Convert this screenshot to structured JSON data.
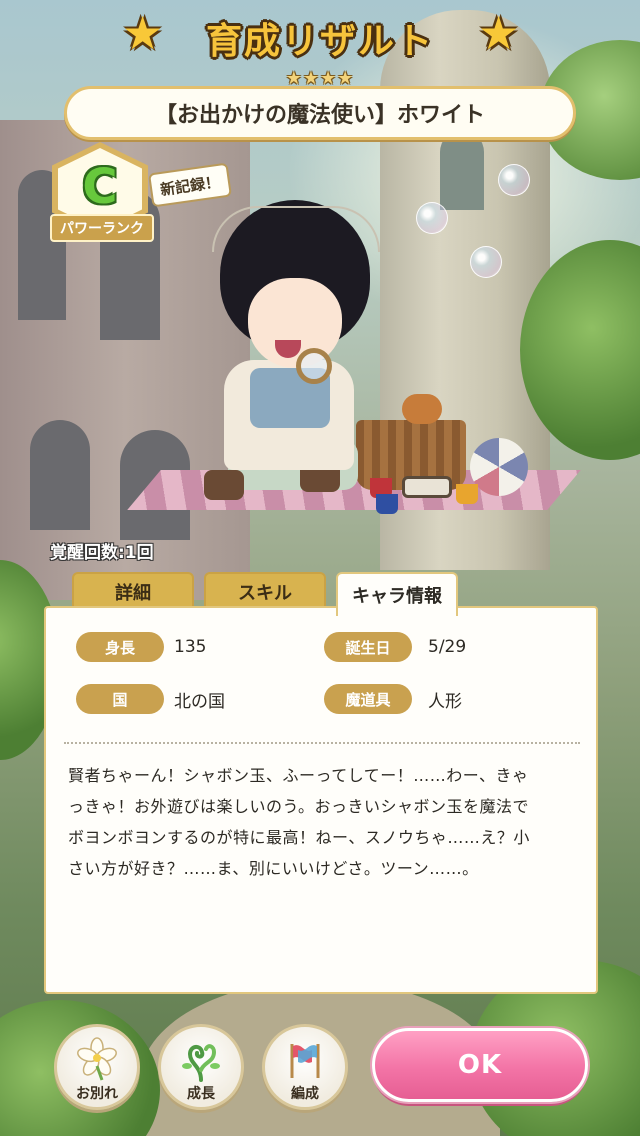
{
  "header": {
    "title": "育成リザルト",
    "rarity_stars": "★★★★",
    "card_name": "【お出かけの魔法使い】ホワイト"
  },
  "rank": {
    "letter": "C",
    "label": "パワーランク",
    "new_record": "新記録！"
  },
  "awakening": "覚醒回数:1回",
  "tabs": [
    {
      "label": "詳細",
      "active": false
    },
    {
      "label": "スキル",
      "active": false
    },
    {
      "label": "キャラ情報",
      "active": true
    }
  ],
  "info": {
    "height_label": "身長",
    "height_value": "135",
    "birthday_label": "誕生日",
    "birthday_value": "5/29",
    "country_label": "国",
    "country_value": "北の国",
    "magic_tool_label": "魔道具",
    "magic_tool_value": "人形",
    "profile_lines": [
      "賢者ちゃーん！シャボン玉、ふーってしてー！……わー、きゃ",
      "っきゃ！お外遊びは楽しいのう。おっきいシャボン玉を魔法で",
      "ボヨンボヨンするのが特に最高！ねー、スノウちゃ……え？小",
      "さい方が好き？……ま、別にいいけどさ。ツーン……。"
    ]
  },
  "buttons": {
    "farewell": "お別れ",
    "growth": "成長",
    "formation": "編成",
    "ok": "OK"
  },
  "colors": {
    "title_gold": "#f7c43c",
    "rank_green": "#67c83c",
    "label_gold": "#c9a14f",
    "ok_pink": "#f374a6"
  }
}
